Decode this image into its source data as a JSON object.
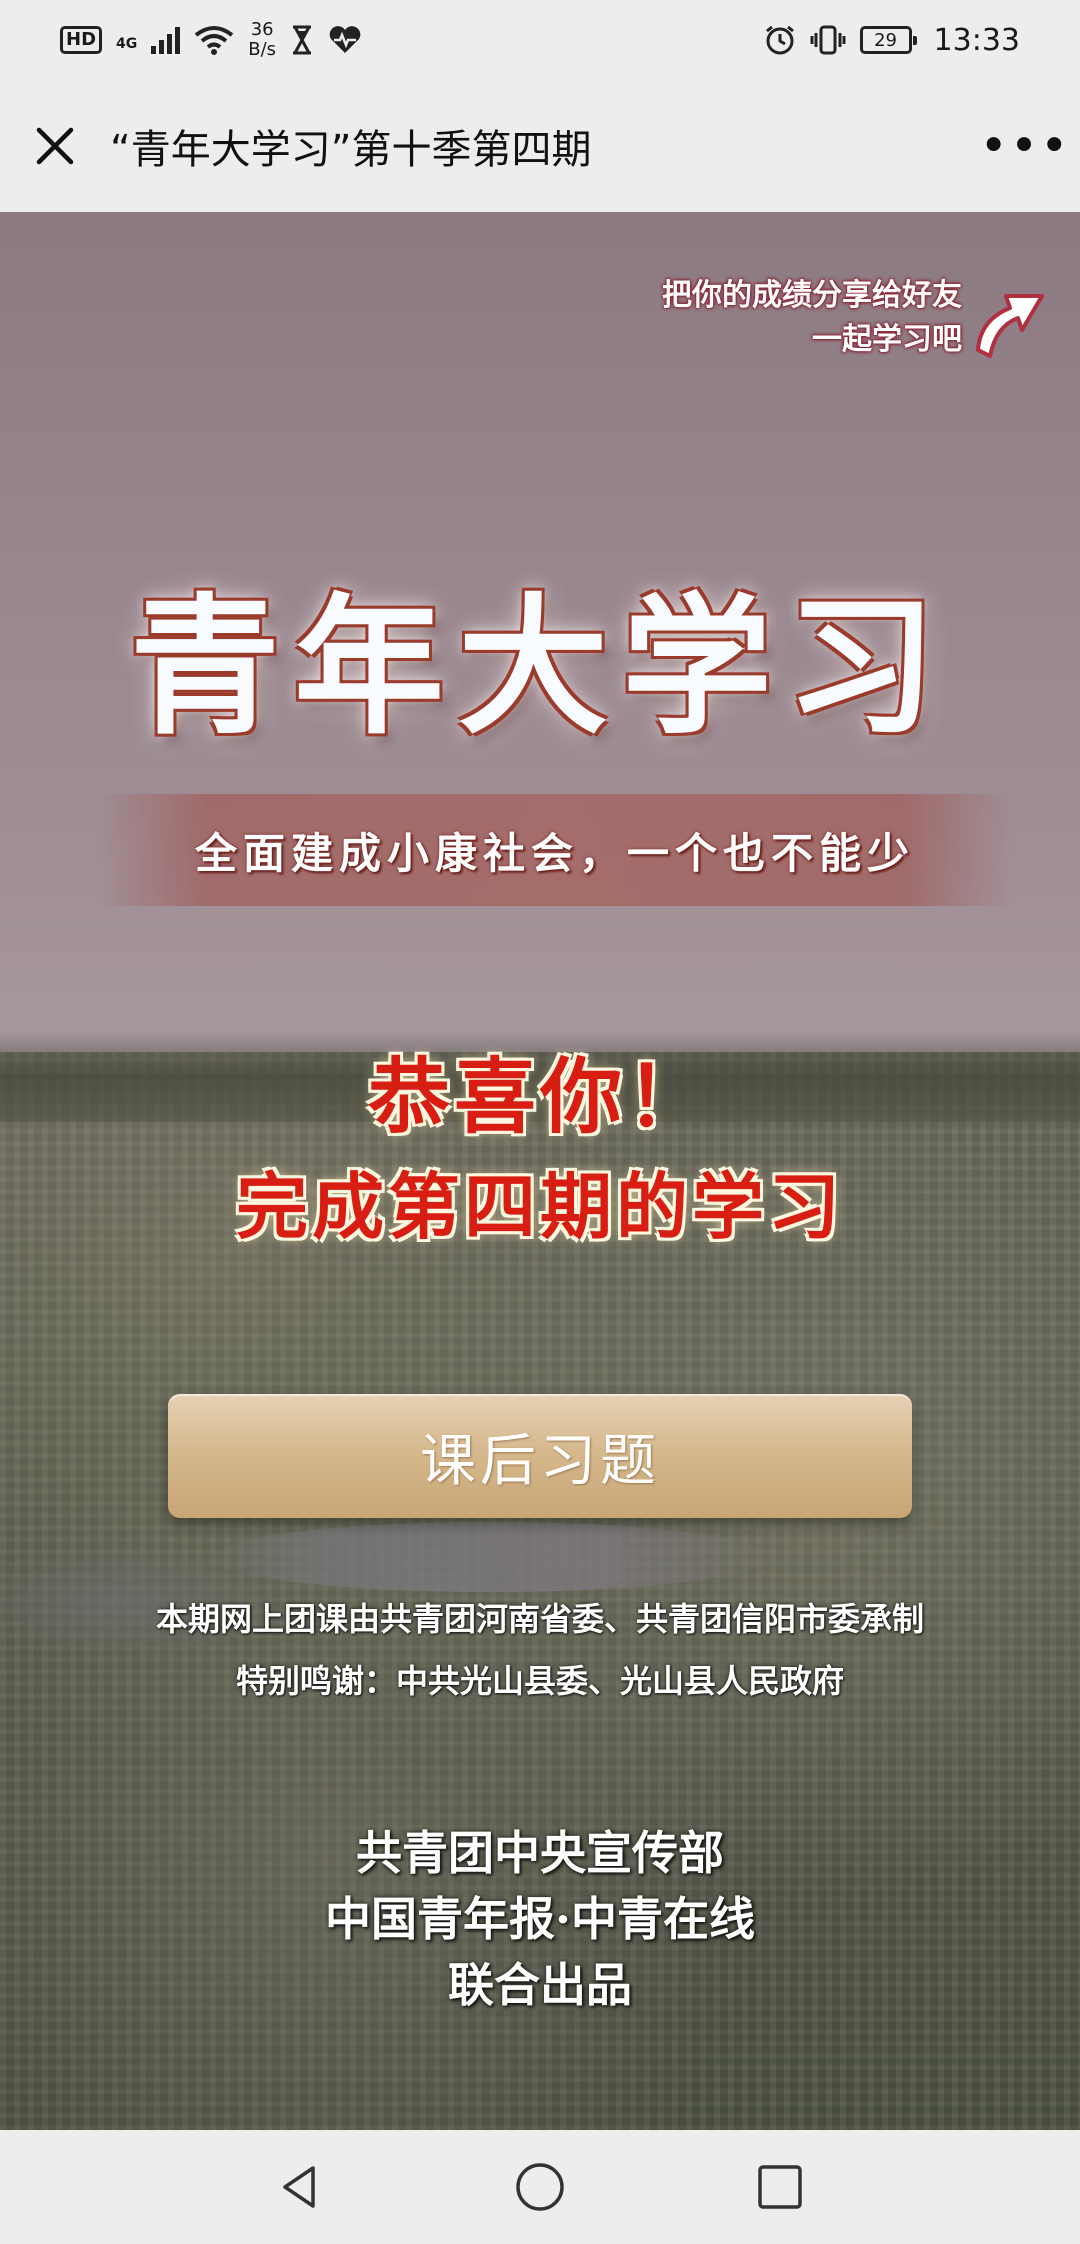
{
  "status_bar": {
    "hd": "HD",
    "network": "4G",
    "speed_value": "36",
    "speed_unit": "B/s",
    "battery": "29",
    "time": "13:33",
    "icons": [
      "hd-icon",
      "signal-icon",
      "wifi-icon",
      "hourglass-icon",
      "heart-icon",
      "alarm-icon",
      "vibrate-icon",
      "battery-icon"
    ]
  },
  "title_bar": {
    "title": "“青年大学习”第十季第四期",
    "close_icon": "close-icon",
    "more_label": "•••"
  },
  "content": {
    "share_tip_line1": "把你的成绩分享给好友",
    "share_tip_line2": "一起学习吧",
    "logo_title": "青年大学习",
    "slogan": "全面建成小康社会，一个也不能少",
    "congrats_line1": "恭喜你！",
    "congrats_line2": "完成第四期的学习",
    "quiz_button": "课后习题",
    "credit_line1": "本期网上团课由共青团河南省委、共青团信阳市委承制",
    "credit_line2": "特别鸣谢：中共光山县委、光山县人民政府",
    "producer_line1": "共青团中央宣传部",
    "producer_line2": "中国青年报·中青在线",
    "producer_line3": "联合出品"
  },
  "colors": {
    "congrats_red": "#d81e12",
    "button_gold": "#d6b98e",
    "bar_bg": "#ededed"
  }
}
